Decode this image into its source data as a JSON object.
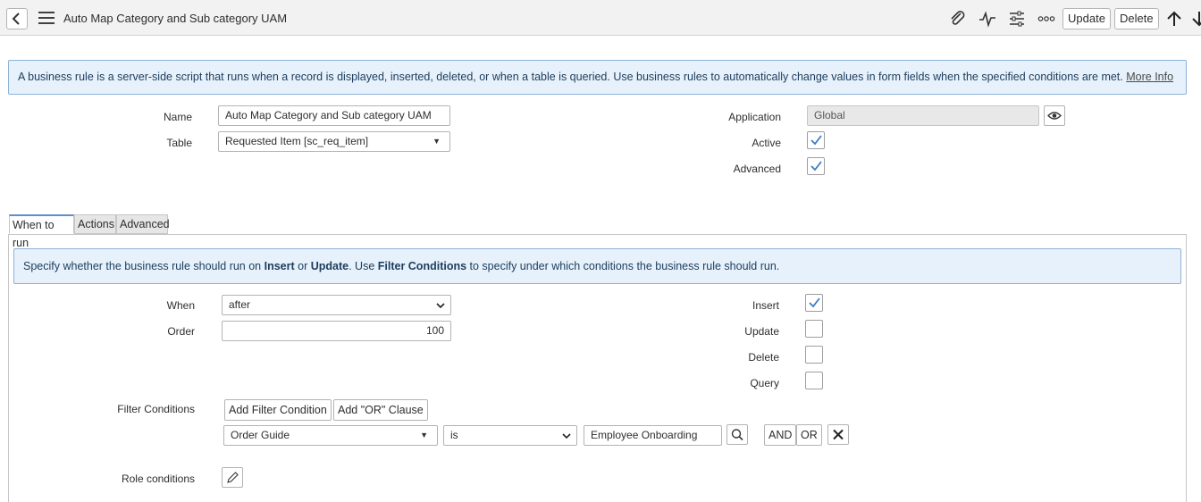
{
  "header": {
    "title": "Auto Map Category and Sub category UAM",
    "update_label": "Update",
    "delete_label": "Delete"
  },
  "info": {
    "text": "A business rule is a server-side script that runs when a record is displayed, inserted, deleted, or when a table is queried. Use business rules to automatically change values in form fields when the specified conditions are met.",
    "more_info": "More Info"
  },
  "form": {
    "name_label": "Name",
    "name_value": "Auto Map Category and Sub category UAM",
    "table_label": "Table",
    "table_value": "Requested Item [sc_req_item]",
    "application_label": "Application",
    "application_value": "Global",
    "active_label": "Active",
    "active_checked": true,
    "advanced_label": "Advanced",
    "advanced_checked": true
  },
  "tabs": [
    {
      "label": "When to run",
      "active": true
    },
    {
      "label": "Actions",
      "active": false
    },
    {
      "label": "Advanced",
      "active": false
    }
  ],
  "when_to_run": {
    "info_parts": [
      "Specify whether the business rule should run on ",
      "Insert",
      " or ",
      "Update",
      ". Use ",
      "Filter Conditions",
      " to specify under which conditions the business rule should run."
    ],
    "when_label": "When",
    "when_value": "after",
    "order_label": "Order",
    "order_value": "100",
    "insert_label": "Insert",
    "insert_checked": true,
    "update_label": "Update",
    "update_checked": false,
    "delete_label": "Delete",
    "delete_checked": false,
    "query_label": "Query",
    "query_checked": false,
    "filter_label": "Filter Conditions",
    "add_filter_label": "Add Filter Condition",
    "add_or_label": "Add \"OR\" Clause",
    "condition": {
      "field": "Order Guide",
      "operator": "is",
      "value": "Employee Onboarding",
      "and_label": "AND",
      "or_label": "OR"
    },
    "role_label": "Role conditions"
  }
}
